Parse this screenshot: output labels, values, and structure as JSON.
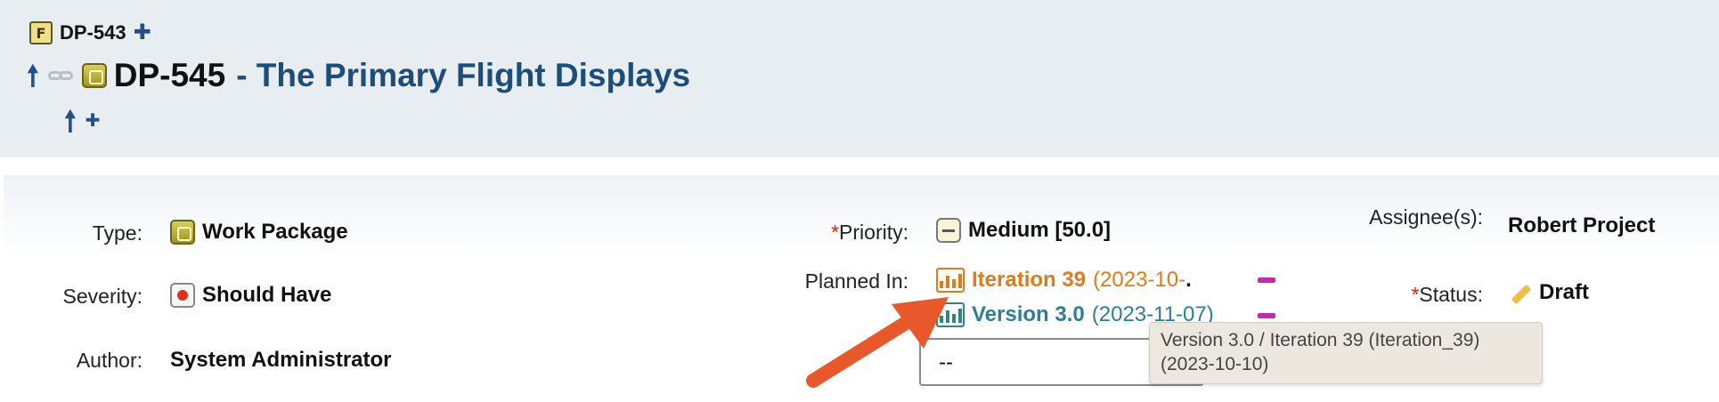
{
  "parent": {
    "id": "DP-543",
    "type_badge": "F"
  },
  "item": {
    "id": "DP-545",
    "title": "- The Primary Flight Displays"
  },
  "fields": {
    "type_label": "Type:",
    "type_value": "Work Package",
    "severity_label": "Severity:",
    "severity_value": "Should Have",
    "author_label": "Author:",
    "author_value": "System Administrator",
    "priority_required": "*",
    "priority_label": "Priority:",
    "priority_value": "Medium [50.0]",
    "planned_label": "Planned In:",
    "plans": [
      {
        "name": "Iteration 39",
        "date": "(2023-10-",
        "suffix": "."
      },
      {
        "name": "Version 3.0",
        "date": "(2023-11-07)"
      }
    ],
    "planned_select_value": "--",
    "assignee_label": "Assignee(s):",
    "assignee_value": "Robert Project",
    "status_required": "*",
    "status_label": "Status:",
    "status_value": "Draft"
  },
  "tooltip": {
    "line1": "Version 3.0 / Iteration 39 (Iteration_39)",
    "line2": "(2023-10-10)"
  },
  "colors": {
    "iteration": "#e07b1a",
    "version": "#2b7f9a",
    "title": "#1d4e7a",
    "annotation_arrow": "#e8582a",
    "remove": "#c22ab0"
  },
  "icons": [
    "feature-icon",
    "add-icon",
    "up-arrow-icon",
    "link-icon",
    "work-package-icon",
    "severity-icon",
    "priority-icon",
    "iteration-icon",
    "version-icon",
    "remove-icon",
    "draft-pencil-icon"
  ]
}
